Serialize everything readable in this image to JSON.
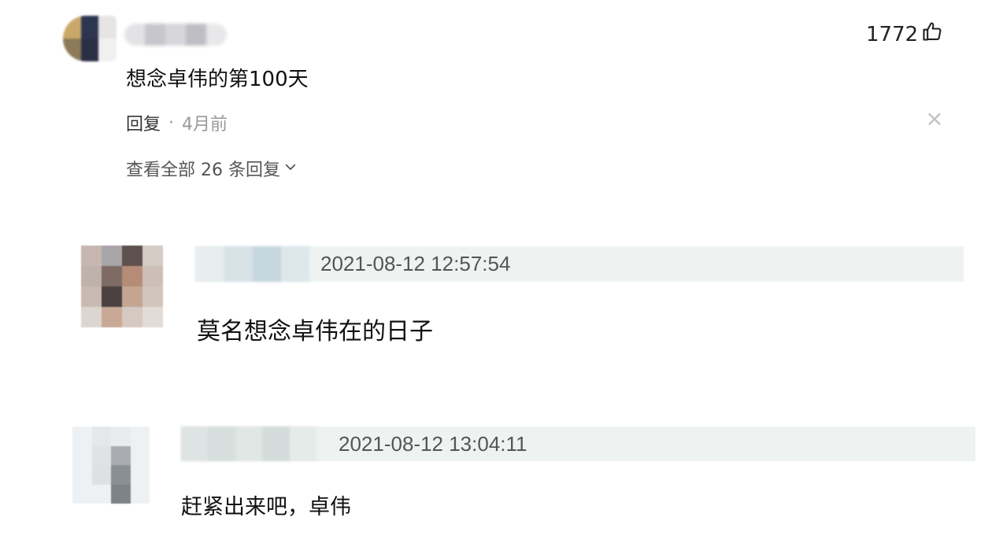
{
  "top_comment": {
    "likes": "1772",
    "text": "想念卓伟的第100天",
    "reply_label": "回复",
    "separator": "·",
    "time_ago": "4月前",
    "close_symbol": "×",
    "view_all_label": "查看全部 26 条回复"
  },
  "replies": [
    {
      "timestamp": "2021-08-12 12:57:54",
      "text": "莫名想念卓伟在的日子"
    },
    {
      "timestamp": "2021-08-12 13:04:11",
      "text": "赶紧出来吧，卓伟"
    }
  ],
  "colors": {
    "header_bg": "#eef3f1",
    "muted_text": "#999999",
    "close_icon": "#c0c0c0"
  },
  "icons": [
    "thumbs-up-icon",
    "close-icon",
    "chevron-down-icon"
  ]
}
